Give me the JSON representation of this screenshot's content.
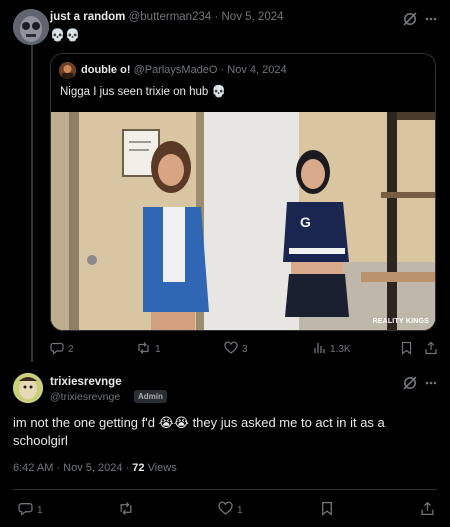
{
  "reply_to_post": {
    "author_name": "just a random",
    "author_handle": "@butterman234",
    "sep": "·",
    "date": "Nov 5, 2024",
    "text": "💀💀",
    "quote": {
      "author_name": "double o!",
      "author_handle": "@ParlaysMadeO",
      "sep": "·",
      "date": "Nov 4, 2024",
      "text": "Nigga I jus seen trixie on hub 💀",
      "media_watermark": "REALITY KINGS"
    },
    "actions": {
      "replies": "2",
      "reposts": "1",
      "likes": "3",
      "views": "1.3K"
    }
  },
  "main_post": {
    "author_name": "trixiesrevnge",
    "author_handle": "@trixiesrevnge",
    "badge": "Admin",
    "text": "im not the one getting f'd 😭😭 they jus asked me to act in it as a schoolgirl",
    "time": "6:42 AM",
    "sep": "·",
    "date": "Nov 5, 2024",
    "sep2": "·",
    "views_count": "72",
    "views_label": "Views",
    "actions": {
      "replies": "1",
      "reposts": "",
      "likes": "1"
    }
  },
  "icons": [
    "grok-icon",
    "more-icon",
    "reply-icon",
    "repost-icon",
    "like-icon",
    "views-icon",
    "bookmark-icon",
    "share-icon"
  ]
}
